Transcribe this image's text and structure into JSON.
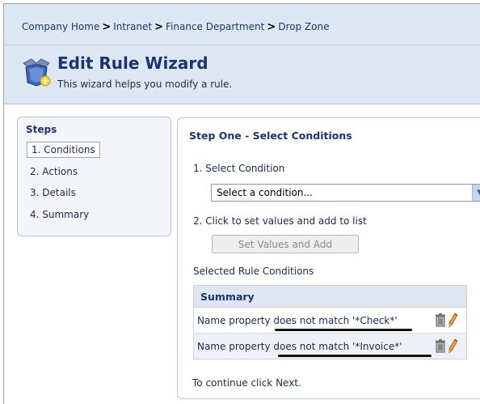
{
  "breadcrumb": {
    "items": [
      "Company Home",
      "Intranet",
      "Finance Department",
      "Drop Zone"
    ],
    "separator": ">"
  },
  "header": {
    "title": "Edit Rule Wizard",
    "subtitle": "This wizard helps you modify a rule.",
    "icon": "wizard-icon"
  },
  "steps": {
    "title": "Steps",
    "items": [
      {
        "label": "1. Conditions",
        "active": true
      },
      {
        "label": "2. Actions",
        "active": false
      },
      {
        "label": "3. Details",
        "active": false
      },
      {
        "label": "4. Summary",
        "active": false
      }
    ]
  },
  "main": {
    "title": "Step One - Select Conditions",
    "select_condition_label": "1.  Select Condition",
    "condition_select_value": "Select a condition...",
    "click_to_set_label": "2.  Click to set values and add to list",
    "set_values_button": "Set Values and Add",
    "selected_conditions_label": "Selected Rule Conditions",
    "table": {
      "header": "Summary",
      "rows": [
        {
          "text": "Name property does not match '*Check*'"
        },
        {
          "text": "Name property does not match '*Invoice*'"
        }
      ]
    },
    "continue_text": "To continue click Next."
  },
  "colors": {
    "header_bg": "#dde6f3",
    "title_blue": "#1b3470",
    "table_header_bg": "#dfe6f1"
  }
}
